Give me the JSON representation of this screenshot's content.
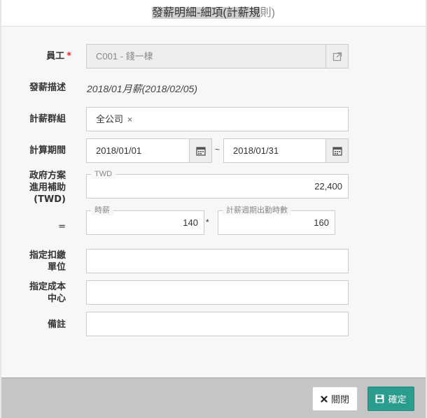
{
  "dialog": {
    "title_highlighted": "發薪明細-細項(計薪規",
    "title_tail": "則)"
  },
  "form": {
    "employee": {
      "label": "員工",
      "required_mark": "*",
      "value": "C001 - 錢一棣"
    },
    "pay_desc": {
      "label": "發薪描述",
      "value": "2018/01月薪(2018/02/05)"
    },
    "pay_group": {
      "label": "計薪群組",
      "tag": "全公司",
      "tag_remove": "×"
    },
    "calc_period": {
      "label": "計算期間",
      "start": "2018/01/01",
      "separator": "~",
      "end": "2018/01/31"
    },
    "subsidy": {
      "label_line1": "政府方案",
      "label_line2": "進用補助",
      "label_line3": "(TWD)",
      "currency_legend": "TWD",
      "value": "22,400"
    },
    "formula": {
      "equals": "=",
      "hourly_legend": "時薪",
      "hourly_value": "140",
      "times": "*",
      "hours_legend": "計薪週期出勤時數",
      "hours_value": "160"
    },
    "deduct_unit": {
      "label_line1": "指定扣繳",
      "label_line2": "單位",
      "value": ""
    },
    "cost_center": {
      "label_line1": "指定成本",
      "label_line2": "中心",
      "value": ""
    },
    "remark": {
      "label": "備註",
      "value": ""
    }
  },
  "footer": {
    "close_label": "關閉",
    "ok_label": "確定"
  },
  "icons": {
    "external_link": "external-link-icon",
    "calendar": "calendar-icon",
    "close": "close-icon",
    "save": "save-icon"
  },
  "colors": {
    "ok_button": "#2a9d8f",
    "required": "#dd3333"
  }
}
